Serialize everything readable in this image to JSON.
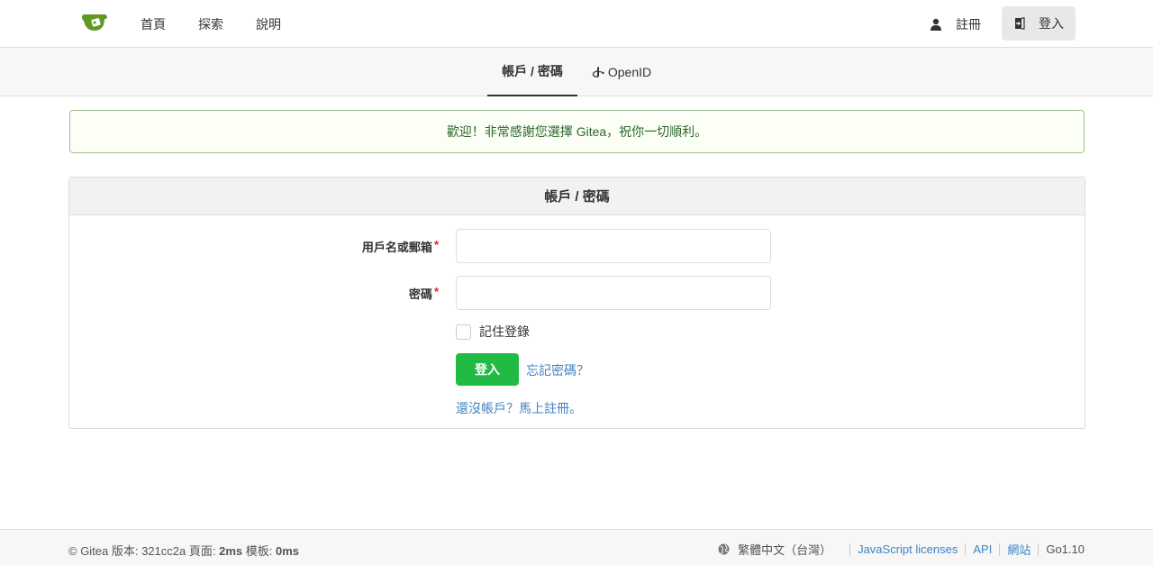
{
  "nav": {
    "home": "首頁",
    "explore": "探索",
    "help": "說明",
    "register": "註冊",
    "login": "登入"
  },
  "tabs": [
    {
      "label": "帳戶 / 密碼",
      "active": true
    },
    {
      "label": "OpenID",
      "active": false
    }
  ],
  "welcome": "歡迎！非常感謝您選擇 Gitea，祝你一切順利。",
  "card": {
    "title": "帳戶 / 密碼",
    "username_label": "用戶名或郵箱",
    "password_label": "密碼",
    "required_mark": "*",
    "remember_label": "記住登錄",
    "login_button": "登入",
    "forgot_link": "忘記密碼？",
    "signup_link": "還沒帳戶？馬上註冊。"
  },
  "footer": {
    "copyright": "© Gitea 版本: 321cc2a 頁面:",
    "page_time": "2ms",
    "template_label": "模板:",
    "template_time": "0ms",
    "language": "繁體中文（台灣）",
    "links": [
      "JavaScript licenses",
      "API",
      "網站"
    ],
    "go_version": "Go1.10"
  },
  "colors": {
    "brand_green": "#609926",
    "button_green": "#21ba45",
    "link_blue": "#4183c4",
    "welcome_bg": "#fcfff5",
    "welcome_text": "#2c662d"
  },
  "icons": {
    "logo": "gitea-logo",
    "register": "user-icon",
    "login": "sign-in-icon",
    "openid": "openid-icon",
    "language": "globe-icon"
  }
}
